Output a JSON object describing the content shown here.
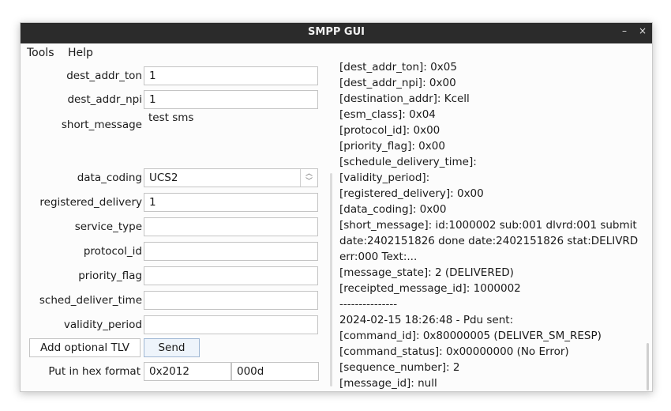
{
  "window": {
    "title": "SMPP GUI",
    "minimize": "–",
    "close": "×"
  },
  "menu": {
    "tools": "Tools",
    "help": "Help"
  },
  "form": {
    "dest_addr_ton": {
      "label": "dest_addr_ton",
      "value": "1"
    },
    "dest_addr_npi": {
      "label": "dest_addr_npi",
      "value": "1"
    },
    "short_message": {
      "label": "short_message",
      "value": "test sms"
    },
    "data_coding": {
      "label": "data_coding",
      "value": "UCS2"
    },
    "registered_delivery": {
      "label": "registered_delivery",
      "value": "1"
    },
    "service_type": {
      "label": "service_type",
      "value": ""
    },
    "protocol_id": {
      "label": "protocol_id",
      "value": ""
    },
    "priority_flag": {
      "label": "priority_flag",
      "value": ""
    },
    "sched_deliver_time": {
      "label": "sched_deliver_time",
      "value": ""
    },
    "validity_period": {
      "label": "validity_period",
      "value": ""
    },
    "add_tlv_label": "Add optional TLV",
    "send_label": "Send",
    "hex_label": "Put in hex format",
    "hex_tag": "0x2012",
    "hex_value": "000d"
  },
  "log": [
    "[dest_addr_ton]: 0x05",
    "[dest_addr_npi]: 0x00",
    "[destination_addr]: Kcell",
    "[esm_class]: 0x04",
    "[protocol_id]: 0x00",
    "[priority_flag]: 0x00",
    "[schedule_delivery_time]:",
    "[validity_period]:",
    "[registered_delivery]: 0x00",
    "[data_coding]: 0x00",
    "[short_message]: id:1000002 sub:001 dlvrd:001 submit",
    "date:2402151826 done date:2402151826 stat:DELIVRD",
    "err:000 Text:...",
    "[message_state]: 2 (DELIVERED)",
    "[receipted_message_id]: 1000002",
    "---------------",
    "2024-02-15 18:26:48 - Pdu sent:",
    "[command_id]: 0x80000005 (DELIVER_SM_RESP)",
    "[command_status]: 0x00000000 (No Error)",
    "[sequence_number]: 2",
    "[message_id]: null"
  ]
}
